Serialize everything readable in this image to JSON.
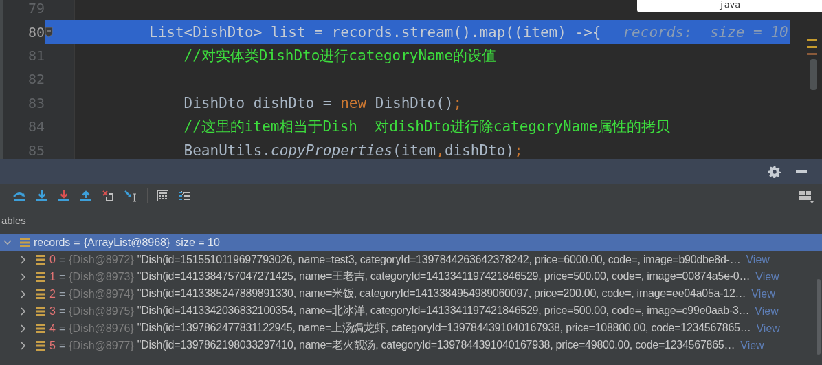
{
  "popup": {
    "text": "java"
  },
  "editor": {
    "lines": [
      {
        "number": "79",
        "current": false
      },
      {
        "number": "80",
        "current": true,
        "segments": [
          {
            "kind": "plain",
            "text": "List<DishDto> list = records.stream().map((item) ->{"
          }
        ],
        "hint": "records:  size = 10"
      },
      {
        "number": "81",
        "current": false,
        "segments": [
          {
            "kind": "comment",
            "text": "    //对实体类DishDto进行categoryName的设值"
          }
        ]
      },
      {
        "number": "82",
        "current": false
      },
      {
        "number": "83",
        "current": false,
        "segments": [
          {
            "kind": "plain",
            "text": "    DishDto dishDto = "
          },
          {
            "kind": "keyword",
            "text": "new"
          },
          {
            "kind": "plain",
            "text": " DishDto()"
          },
          {
            "kind": "punct",
            "text": ";"
          }
        ]
      },
      {
        "number": "84",
        "current": false,
        "segments": [
          {
            "kind": "comment",
            "text": "    //这里的item相当于Dish  对dishDto进行除categoryName属性的拷贝"
          }
        ]
      },
      {
        "number": "85",
        "current": false,
        "segments": [
          {
            "kind": "plain",
            "text": "    BeanUtils."
          },
          {
            "kind": "italic",
            "text": "copyProperties"
          },
          {
            "kind": "plain",
            "text": "(item"
          },
          {
            "kind": "punct",
            "text": ","
          },
          {
            "kind": "plain",
            "text": "dishDto)"
          },
          {
            "kind": "punct",
            "text": ";"
          }
        ]
      }
    ]
  },
  "toolbar": [
    {
      "kind": "step-over"
    },
    {
      "kind": "step-into"
    },
    {
      "kind": "force-step-into"
    },
    {
      "kind": "step-out"
    },
    {
      "kind": "drop-frame"
    },
    {
      "kind": "run-to-cursor"
    },
    {
      "kind": "separator"
    },
    {
      "kind": "evaluate"
    },
    {
      "kind": "trace"
    }
  ],
  "variables_tab": {
    "label": "ables"
  },
  "tree": {
    "root": {
      "name": "records",
      "op": "=",
      "type": "{ArrayList@8968}",
      "info": "size = 10",
      "expanded": true,
      "selected": true,
      "children": [
        {
          "name": "0",
          "op": "=",
          "type": "{Dish@8972}",
          "value": "\"Dish(id=1515510119697793026, name=test3, categoryId=1397844263642378242, price=6000.00, code=, image=b90dbe8d-…",
          "link": "View",
          "expanded": false,
          "selected": false
        },
        {
          "name": "1",
          "op": "=",
          "type": "{Dish@8973}",
          "value": "\"Dish(id=1413384757047271425, name=王老吉, categoryId=1413341197421846529, price=500.00, code=, image=00874a5e-0…",
          "link": "View",
          "expanded": false,
          "selected": false
        },
        {
          "name": "2",
          "op": "=",
          "type": "{Dish@8974}",
          "value": "\"Dish(id=1413385247889891330, name=米饭, categoryId=1413384954989060097, price=200.00, code=, image=ee04a05a-12…",
          "link": "View",
          "expanded": false,
          "selected": false
        },
        {
          "name": "3",
          "op": "=",
          "type": "{Dish@8975}",
          "value": "\"Dish(id=1413342036832100354, name=北冰洋, categoryId=1413341197421846529, price=500.00, code=, image=c99e0aab-3…",
          "link": "View",
          "expanded": false,
          "selected": false
        },
        {
          "name": "4",
          "op": "=",
          "type": "{Dish@8976}",
          "value": "\"Dish(id=1397862477831122945, name=上汤焗龙虾, categoryId=1397844391040167938, price=108800.00, code=1234567865…",
          "link": "View",
          "expanded": false,
          "selected": false
        },
        {
          "name": "5",
          "op": "=",
          "type": "{Dish@8977}",
          "value": "\"Dish(id=1397862198033297410, name=老火靓汤, categoryId=1397844391040167938, price=49800.00, code=1234567865…",
          "link": "View",
          "expanded": false,
          "selected": false
        }
      ]
    }
  }
}
